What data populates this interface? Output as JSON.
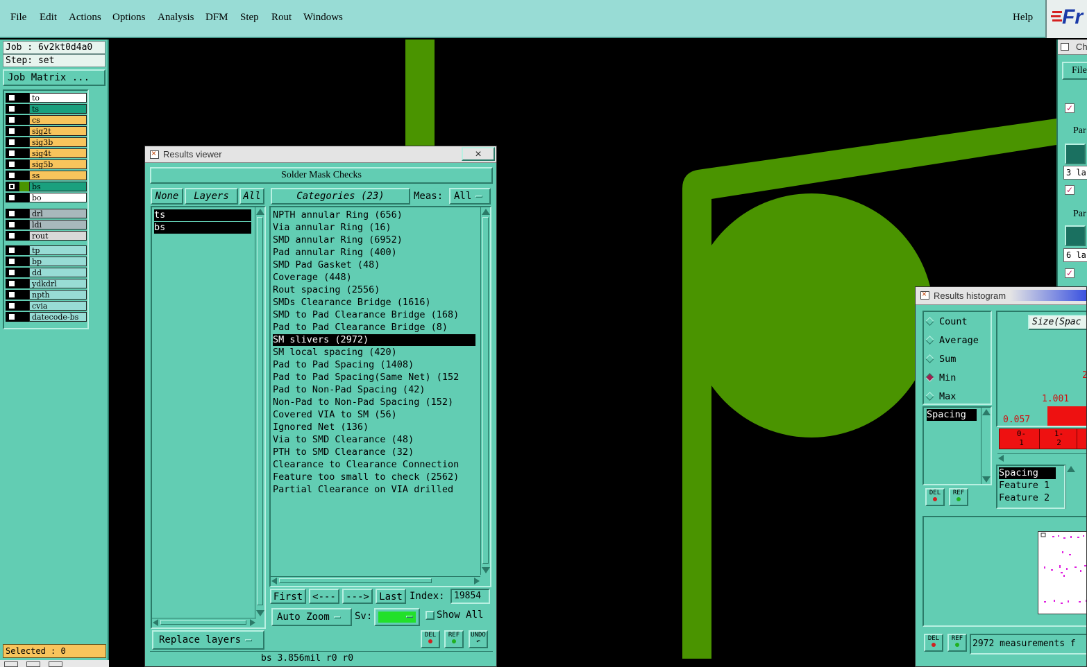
{
  "menu": {
    "items": [
      "File",
      "Edit",
      "Actions",
      "Options",
      "Analysis",
      "DFM",
      "Step",
      "Rout",
      "Windows"
    ],
    "help": "Help",
    "logo_text": "Fr"
  },
  "job": {
    "job_line": "Job : 6v2kt0d4a0",
    "step_line": "Step: set",
    "matrix_button": "Job Matrix ..."
  },
  "layers": [
    {
      "name": "to",
      "color": "#ffffff",
      "checked": false
    },
    {
      "name": "ts",
      "color": "#1aa07e",
      "checked": false
    },
    {
      "name": "cs",
      "color": "#f8c45c",
      "checked": false
    },
    {
      "name": "sig2t",
      "color": "#f8c45c",
      "checked": false
    },
    {
      "name": "sig3b",
      "color": "#f8c45c",
      "checked": false
    },
    {
      "name": "sig4t",
      "color": "#f8c45c",
      "checked": false
    },
    {
      "name": "sig5b",
      "color": "#f8c45c",
      "checked": false
    },
    {
      "name": "ss",
      "color": "#f8c45c",
      "checked": false
    },
    {
      "name": "bs",
      "color": "#1aa07e",
      "checked": true
    },
    {
      "name": "bo",
      "color": "#ffffff",
      "checked": false
    },
    {
      "name": "drl",
      "color": "#a8b8bc",
      "checked": false
    },
    {
      "name": "ldi",
      "color": "#a8b8bc",
      "checked": false
    },
    {
      "name": "rout",
      "color": "#d8d8d8",
      "checked": false
    },
    {
      "name": "tp",
      "color": "#98dcd5",
      "checked": false
    },
    {
      "name": "bp",
      "color": "#98dcd5",
      "checked": false
    },
    {
      "name": "dd",
      "color": "#98dcd5",
      "checked": false
    },
    {
      "name": "ydkdrl",
      "color": "#98dcd5",
      "checked": false
    },
    {
      "name": "npth",
      "color": "#98dcd5",
      "checked": false
    },
    {
      "name": "cvia",
      "color": "#98dcd5",
      "checked": false
    },
    {
      "name": "datecode-bs",
      "color": "#98dcd5",
      "checked": false
    }
  ],
  "selected_status": "Selected : 0",
  "results_viewer": {
    "title": "Results viewer",
    "close": "×",
    "header": "Solder Mask Checks",
    "btn_none": "None",
    "btn_layers": "Layers",
    "btn_all": "All",
    "layer_items": [
      "ts",
      "bs"
    ],
    "categories_btn": "Categories (23)",
    "meas_label": "Meas:",
    "meas_value": "All",
    "categories": [
      "NPTH annular Ring (656)",
      "Via annular Ring (16)",
      "SMD annular Ring (6952)",
      "Pad annular Ring (400)",
      "SMD Pad Gasket (48)",
      "Coverage (448)",
      "Rout spacing (2556)",
      "SMDs Clearance Bridge (1616)",
      "SMD to Pad Clearance Bridge (168)",
      "Pad to Pad Clearance Bridge (8)",
      "SM slivers (2972)",
      "SM local spacing (420)",
      "Pad to Pad Spacing (1408)",
      "Pad to Pad Spacing(Same Net) (152",
      "Pad to Non-Pad Spacing (42)",
      "Non-Pad to Non-Pad Spacing (152)",
      "Covered VIA to SM (56)",
      "Ignored Net (136)",
      "Via to SMD Clearance (48)",
      "PTH to SMD Clearance (32)",
      "Clearance to Clearance Connection",
      "Feature too small to check (2562)",
      "Partial Clearance on VIA drilled"
    ],
    "selected_category": "SM slivers (2972)",
    "nav": {
      "first": "First",
      "prev": "<---",
      "next": "--->",
      "last": "Last",
      "index_label": "Index:",
      "index_value": "19854"
    },
    "auto_zoom": "Auto Zoom",
    "sv_label": "Sv:",
    "show_all": "Show All",
    "replace_layers": "Replace layers",
    "del": "DEL",
    "ref": "REF",
    "undo": "UNDO",
    "status": "bs 3.856mil  r0  r0"
  },
  "right_strip": {
    "partial_labels": [
      "Ch",
      "File",
      "Par",
      "3 la",
      "Par",
      "6 la"
    ]
  },
  "histogram": {
    "title": "Results histogram",
    "modes": [
      "Count",
      "Average",
      "Sum",
      "Min",
      "Max"
    ],
    "selected_mode": "Min",
    "measure_item": "Spacing",
    "size_label": "Size(Spac",
    "bar_labels": [
      "0.057",
      "1.001",
      "2"
    ],
    "bins": [
      "0-\n1",
      "1-\n2"
    ],
    "fields": [
      "Spacing",
      "Feature 1",
      "Feature 2"
    ],
    "del": "DEL",
    "ref": "REF",
    "measurements": "2972 measurements f"
  },
  "colors": {
    "panel_teal": "#62cdb3",
    "menu_bg": "#98dcd5",
    "copper_green": "#4a9400",
    "sv_green": "#22e02a",
    "bar_red": "#ee1111"
  }
}
